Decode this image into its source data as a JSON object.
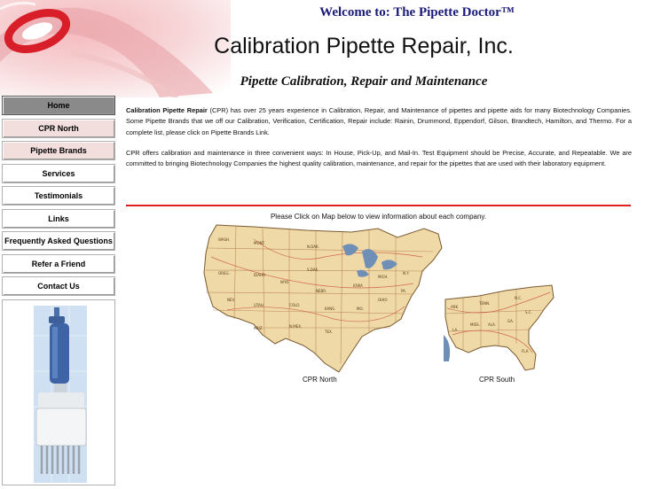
{
  "header": {
    "welcome": "Welcome to: The Pipette Doctor™",
    "company": "Calibration Pipette Repair, Inc.",
    "tagline": "Pipette Calibration, Repair and Maintenance"
  },
  "nav": {
    "items": [
      {
        "label": "Home"
      },
      {
        "label": "CPR North"
      },
      {
        "label": "Pipette Brands"
      },
      {
        "label": "Services"
      },
      {
        "label": "Testimonials"
      },
      {
        "label": "Links"
      },
      {
        "label": "Frequently Asked Questions"
      },
      {
        "label": "Refer a Friend"
      },
      {
        "label": "Contact Us"
      }
    ]
  },
  "main": {
    "intro1_bold": "Calibration Pipette Repair",
    "intro1_rest": " (CPR) has over 25 years experience in Calibration, Repair, and Maintenance of pipettes and pipette aids for many Biotechnology Companies. Some Pipette Brands that we off our Calibration, Verification, Certification, Repair include: Rainin, Drummond, Eppendorf, Gilson, Brandtech, Hamilton, and Thermo. For a complete list, please click on Pipette Brands Link.",
    "intro2": "CPR offers calibration and maintenance in three convenient ways: In House, Pick-Up, and Mail-In. Test Equipment should be Precise, Accurate, and Repeatable. We are committed to bringing Biotechnology Companies the highest quality calibration, maintenance, and repair for the pipettes that are used with their laboratory equipment.",
    "map_instruction": "Please Click on Map below to view information about each company.",
    "map_north_caption": "CPR North",
    "map_south_caption": "CPR South"
  },
  "colors": {
    "accent_red": "#e02020",
    "welcome_blue": "#1a1a7a",
    "nav_pink": "#f3dede",
    "nav_active": "#8a8a8a",
    "map_land": "#efd9a6",
    "map_water": "#6f8fb6"
  }
}
